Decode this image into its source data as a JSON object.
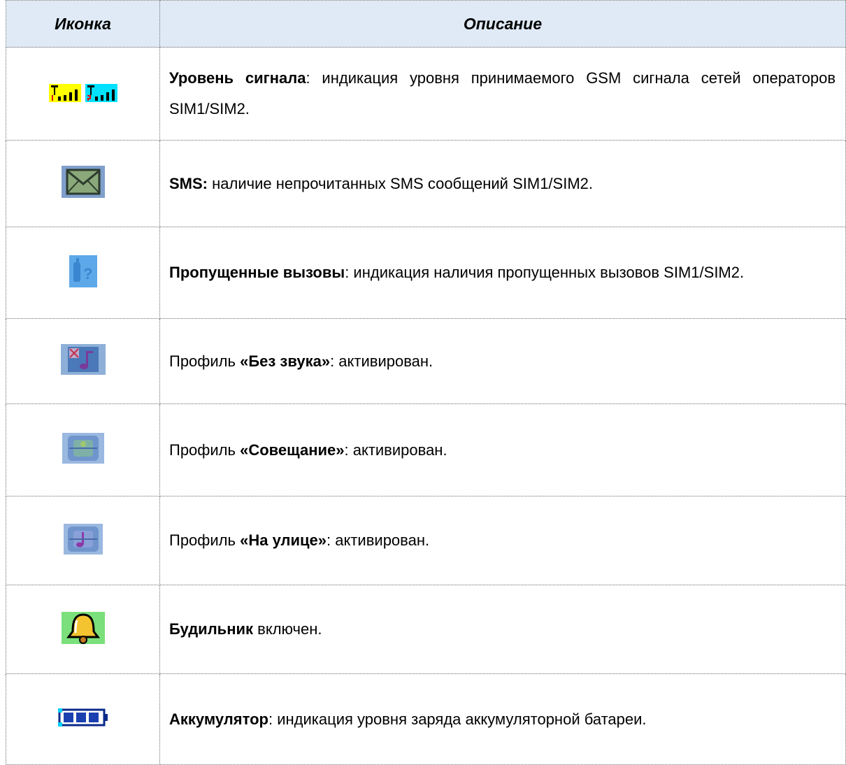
{
  "table": {
    "headers": {
      "icon": "Иконка",
      "description": "Описание"
    },
    "rows": [
      {
        "icon": "signal-strength-sim1-sim2-icon",
        "prefix": "",
        "bold": "Уровень сигнала",
        "suffix": ": индикация уровня принимаемого GSM сигнала сетей операторов SIM1/SIM2."
      },
      {
        "icon": "sms-envelope-icon",
        "prefix": "",
        "bold": "SMS:",
        "suffix": " наличие непрочитанных SMS сообщений SIM1/SIM2."
      },
      {
        "icon": "missed-call-icon",
        "prefix": "",
        "bold": "Пропущенные вызовы",
        "suffix": ": индикация наличия пропущенных вызовов SIM1/SIM2."
      },
      {
        "icon": "silent-profile-icon",
        "prefix": "Профиль ",
        "bold": "«Без звука»",
        "suffix": ": активирован."
      },
      {
        "icon": "meeting-profile-icon",
        "prefix": "Профиль ",
        "bold": "«Совещание»",
        "suffix": ": активирован."
      },
      {
        "icon": "outdoor-profile-icon",
        "prefix": "Профиль ",
        "bold": "«На улице»",
        "suffix": ": активирован."
      },
      {
        "icon": "alarm-bell-icon",
        "prefix": "",
        "bold": "Будильник",
        "suffix": " включен."
      },
      {
        "icon": "battery-icon",
        "prefix": "",
        "bold": "Аккумулятор",
        "suffix": ": индикация уровня заряда аккумуляторной батареи."
      }
    ]
  },
  "colors": {
    "header_bg": "#dfeaf6",
    "border": "#6b6b6b"
  }
}
